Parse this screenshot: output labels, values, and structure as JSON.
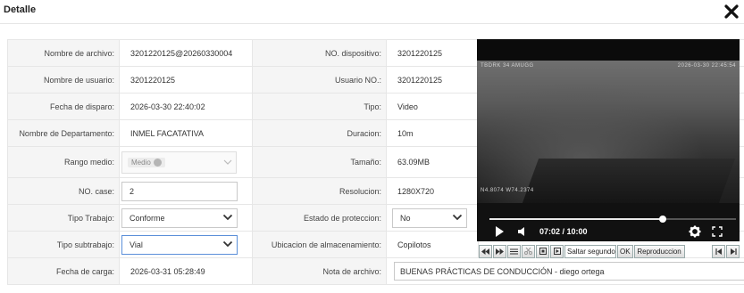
{
  "dialog": {
    "title": "Detalle",
    "close_icon": "close-icon"
  },
  "fields": {
    "nombre_archivo": {
      "label": "Nombre de archivo:",
      "value": "3201220125@20260330004"
    },
    "nombre_usuario": {
      "label": "Nombre de usuario:",
      "value": "3201220125"
    },
    "fecha_disparo": {
      "label": "Fecha de disparo:",
      "value": "2026-03-30 22:40:02"
    },
    "departamento": {
      "label": "Nombre de Departamento:",
      "value": "INMEL FACATATIVA"
    },
    "rango_medio": {
      "label": "Rango medio:",
      "tag": "Medio"
    },
    "no_case": {
      "label": "NO. case:",
      "value": "2"
    },
    "tipo_trabajo": {
      "label": "Tipo Trabajo:",
      "value": "Conforme"
    },
    "tipo_subtrabajo": {
      "label": "Tipo subtrabajo:",
      "value": "Vial"
    },
    "fecha_carga": {
      "label": "Fecha de carga:",
      "value": "2026-03-31 05:28:49"
    },
    "no_dispositivo": {
      "label": "NO. dispositivo:",
      "value": "3201220125"
    },
    "usuario_no": {
      "label": "Usuario NO.:",
      "value": "3201220125"
    },
    "tipo": {
      "label": "Tipo:",
      "value": "Video"
    },
    "duracion": {
      "label": "Duracion:",
      "value": "10m"
    },
    "tamano": {
      "label": "Tamaño:",
      "value": "63.09MB"
    },
    "resolucion": {
      "label": "Resolucion:",
      "value": "1280X720"
    },
    "estado_proteccion": {
      "label": "Estado de proteccion:",
      "value": "No"
    },
    "ubicacion": {
      "label": "Ubicacion de almacenamiento:",
      "value": "Copilotos"
    },
    "nota_archivo": {
      "label": "Nota de archivo:",
      "value": "BUENAS PRÁCTICAS DE CONDUCCIÓN - diego ortega"
    }
  },
  "video": {
    "time": "07:02 / 10:00",
    "progress": 0.702,
    "osd_top_left": "TBDRK 34 AMUGG",
    "osd_top_right": "2026-03-30 22:45:54",
    "osd_bottom_left": "N4.8074 W74.2374"
  },
  "toolbar": {
    "skip_placeholder": "Saltar segundo",
    "ok_label": "OK",
    "playback_label": "Reproduccion"
  },
  "colors": {
    "focus_border": "#5b8fd9",
    "label_bg": "#f5f5f5"
  }
}
